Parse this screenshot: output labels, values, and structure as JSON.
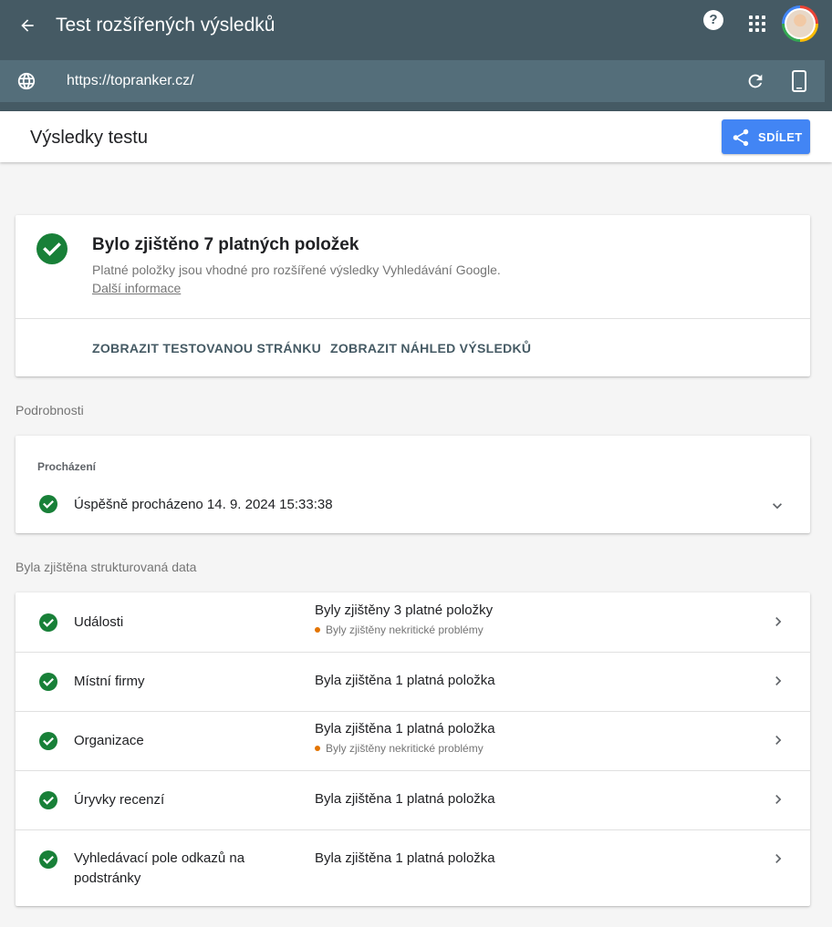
{
  "header": {
    "title": "Test rozšířených výsledků",
    "help_glyph": "?",
    "url": "https://topranker.cz/"
  },
  "results_header": {
    "title": "Výsledky testu",
    "share_label": "SDÍLET"
  },
  "summary": {
    "heading": "Bylo zjištěno 7 platných položek",
    "description": "Platné položky jsou vhodné pro rozšířené výsledky Vyhledávání Google.",
    "more_link": "Další informace",
    "actions": [
      "ZOBRAZIT TESTOVANOU STRÁNKU",
      "ZOBRAZIT NÁHLED VÝSLEDKŮ"
    ]
  },
  "details": {
    "section_label": "Podrobnosti",
    "crawl_label": "Procházení",
    "crawl_status": "Úspěšně procházeno 14. 9. 2024 15:33:38"
  },
  "structured_data": {
    "section_label": "Byla zjištěna strukturovaná data",
    "items": [
      {
        "name": "Události",
        "count": "Byly zjištěny 3 platné položky",
        "warning": "Byly zjištěny nekritické problémy"
      },
      {
        "name": "Místní firmy",
        "count": "Byla zjištěna 1 platná položka",
        "warning": ""
      },
      {
        "name": "Organizace",
        "count": "Byla zjištěna 1 platná položka",
        "warning": "Byly zjištěny nekritické problémy"
      },
      {
        "name": "Úryvky recenzí",
        "count": "Byla zjištěna 1 platná položka",
        "warning": ""
      },
      {
        "name": "Vyhledávací pole odkazů na podstránky",
        "count": "Byla zjištěna 1 platná položka",
        "warning": ""
      }
    ]
  },
  "colors": {
    "appbar": "#455a64",
    "urlbar": "#546e7a",
    "share_button": "#4285f4",
    "success": "#188038",
    "warning": "#e37400"
  },
  "icons": [
    "back-arrow-icon",
    "help-icon",
    "apps-grid-icon",
    "avatar",
    "globe-icon",
    "reload-icon",
    "mobile-device-icon",
    "share-icon",
    "check-circle-icon",
    "chevron-down-icon",
    "chevron-right-icon"
  ]
}
